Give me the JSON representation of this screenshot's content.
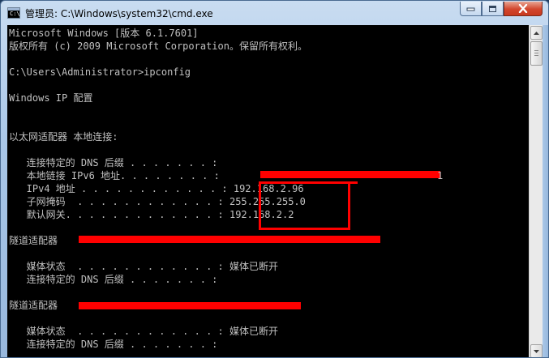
{
  "window": {
    "title": "管理员: C:\\Windows\\system32\\cmd.exe",
    "icon": "cmd-icon",
    "icon_prompt": "C:\\",
    "controls": [
      "minimize-icon",
      "maximize-icon",
      "close-icon"
    ]
  },
  "console": {
    "lines": [
      "Microsoft Windows [版本 6.1.7601]",
      "版权所有 (c) 2009 Microsoft Corporation。保留所有权利。",
      "",
      "C:\\Users\\Administrator>ipconfig",
      "",
      "Windows IP 配置",
      "",
      "",
      "以太网适配器 本地连接:",
      "",
      "   连接特定的 DNS 后缀 . . . . . . . :",
      "   本地链接 IPv6 地址. . . . . . . . :",
      "   IPv4 地址 . . . . . . . . . . . . : 192.168.2.96",
      "   子网掩码  . . . . . . . . . . . . : 255.255.255.0",
      "   默认网关. . . . . . . . . . . . . : 192.168.2.2",
      "",
      "隧道适配器",
      "",
      "   媒体状态  . . . . . . . . . . . . : 媒体已断开",
      "   连接特定的 DNS 后缀 . . . . . . . :",
      "",
      "隧道适配器",
      "",
      "   媒体状态  . . . . . . . . . . . . : 媒体已断开",
      "   连接特定的 DNS 后缀 . . . . . . . :"
    ],
    "ipv6_tail": "1",
    "colors": {
      "background": "#000000",
      "text": "#c0c0c0",
      "redaction": "#ff0000"
    }
  },
  "scrollbar": {
    "up": "scroll-up-arrow-icon",
    "down": "scroll-down-arrow-icon"
  }
}
